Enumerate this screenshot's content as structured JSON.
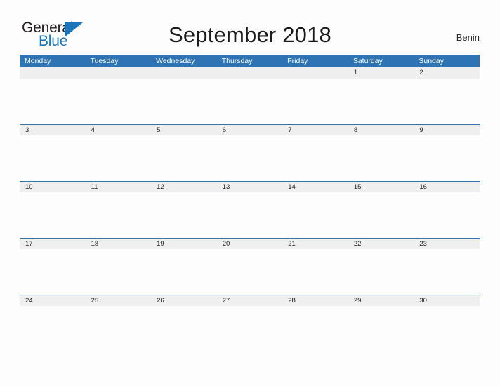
{
  "logo": {
    "word_general": "General",
    "word_blue": "Blue",
    "triangle_icon": "triangle-icon",
    "accent_color": "#1b75bc"
  },
  "header": {
    "title": "September 2018",
    "country": "Benin"
  },
  "calendar": {
    "header_color": "#2e74b5",
    "strip_color": "#efefef",
    "weekdays": [
      "Monday",
      "Tuesday",
      "Wednesday",
      "Thursday",
      "Friday",
      "Saturday",
      "Sunday"
    ],
    "weeks": [
      [
        "",
        "",
        "",
        "",
        "",
        "1",
        "2"
      ],
      [
        "3",
        "4",
        "5",
        "6",
        "7",
        "8",
        "9"
      ],
      [
        "10",
        "11",
        "12",
        "13",
        "14",
        "15",
        "16"
      ],
      [
        "17",
        "18",
        "19",
        "20",
        "21",
        "22",
        "23"
      ],
      [
        "24",
        "25",
        "26",
        "27",
        "28",
        "29",
        "30"
      ]
    ]
  }
}
